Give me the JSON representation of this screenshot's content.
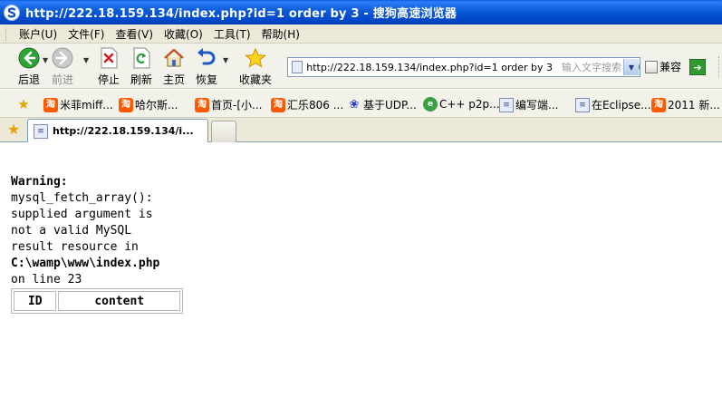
{
  "window": {
    "title": "http://222.18.159.134/index.php?id=1 order by 3 - 搜狗高速浏览器"
  },
  "menu": [
    "账户(U)",
    "文件(F)",
    "查看(V)",
    "收藏(O)",
    "工具(T)",
    "帮助(H)"
  ],
  "toolbar": {
    "back": "后退",
    "forward": "前进",
    "stop": "停止",
    "refresh": "刷新",
    "home": "主页",
    "restore": "恢复",
    "favorites": "收藏夹",
    "compat": "兼容"
  },
  "address": {
    "url": "http://222.18.159.134/index.php?id=1 order by 3",
    "search_placeholder": "输入文字搜索"
  },
  "bookmarks": [
    "米菲miff...",
    "哈尔斯...",
    "首页-[小...",
    "汇乐806 ...",
    "基于UDP...",
    "C++ p2p...",
    "编写端...",
    "在Eclipse...",
    "2011 新..."
  ],
  "tab": {
    "title": "http://222.18.159.134/i..."
  },
  "page": {
    "warning_label": "Warning:",
    "line1": "mysql_fetch_array():",
    "line2": "supplied argument is",
    "line3": "not a valid MySQL",
    "line4": "result resource in",
    "path": "C:\\wamp\\www\\index.php",
    "line6": "on line 23",
    "table_headers": [
      "ID",
      "content"
    ]
  },
  "colors": {
    "titlebar": "#0b5ad8",
    "chrome": "#ece9d8"
  }
}
